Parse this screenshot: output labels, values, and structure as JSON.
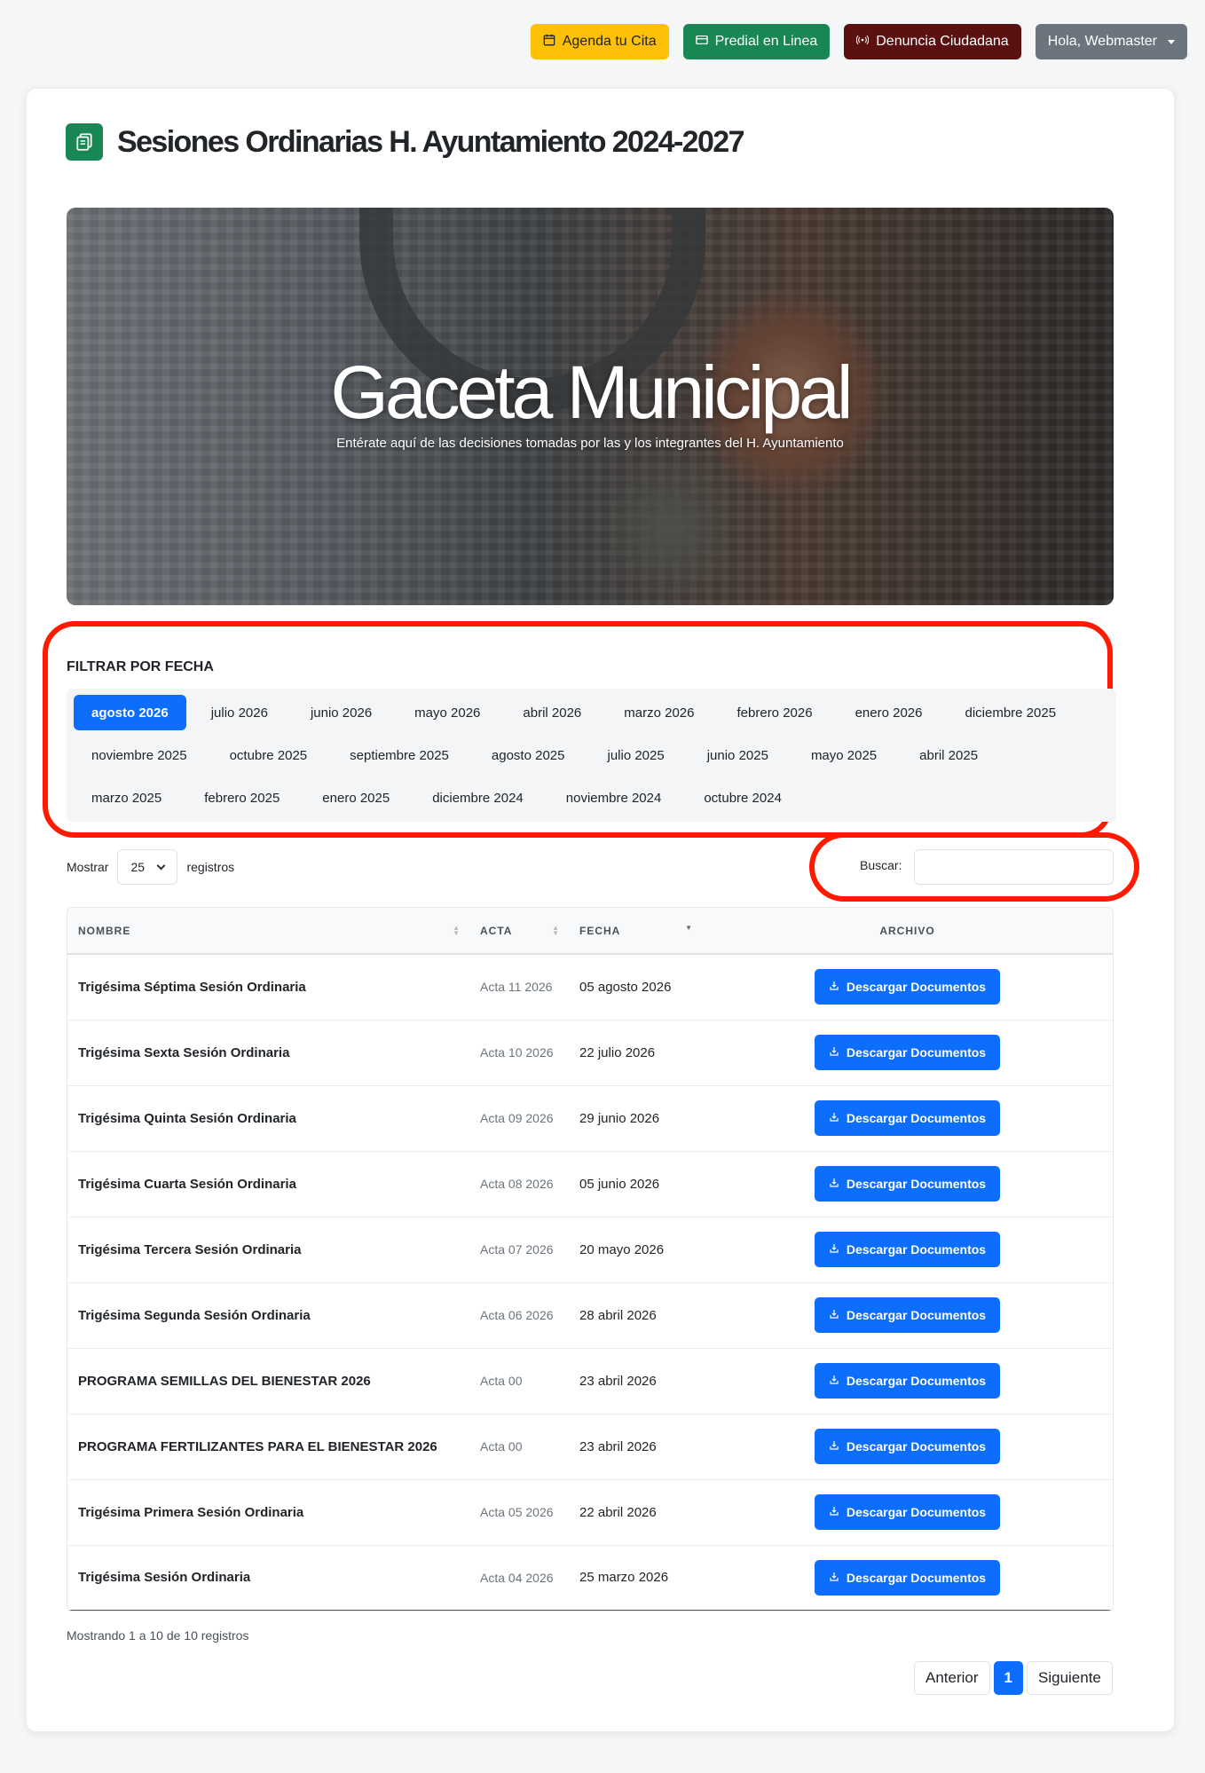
{
  "topbar": {
    "cita": "Agenda tu Cita",
    "predial": "Predial en Linea",
    "denuncia": "Denuncia Ciudadana",
    "user": "Hola, Webmaster"
  },
  "page_title": "Sesiones Ordinarias H. Ayuntamiento 2024-2027",
  "hero": {
    "title": "Gaceta Municipal",
    "subtitle": "Entérate aquí de las decisiones tomadas por las y los integrantes del H. Ayuntamiento"
  },
  "filter": {
    "label": "FILTRAR POR FECHA",
    "months": [
      "agosto 2026",
      "julio 2026",
      "junio 2026",
      "mayo 2026",
      "abril 2026",
      "marzo 2026",
      "febrero 2026",
      "enero 2026",
      "diciembre 2025",
      "noviembre 2025",
      "octubre 2025",
      "septiembre 2025",
      "agosto 2025",
      "julio 2025",
      "junio 2025",
      "mayo 2025",
      "abril 2025",
      "marzo 2025",
      "febrero 2025",
      "enero 2025",
      "diciembre 2024",
      "noviembre 2024",
      "octubre 2024"
    ],
    "active": "agosto 2026"
  },
  "controls": {
    "show_label": "Mostrar",
    "page_size": "25",
    "records_label": "registros",
    "search_label": "Buscar:",
    "search_value": ""
  },
  "table": {
    "headers": [
      "NOMBRE",
      "ACTA",
      "FECHA",
      "ARCHIVO"
    ],
    "button_label": "Descargar Documentos",
    "rows": [
      {
        "nombre": "Trigésima Séptima Sesión Ordinaria",
        "acta": "Acta 11 2026",
        "fecha": "05 agosto 2026"
      },
      {
        "nombre": "Trigésima Sexta Sesión Ordinaria",
        "acta": "Acta 10 2026",
        "fecha": "22 julio 2026"
      },
      {
        "nombre": "Trigésima Quinta Sesión Ordinaria",
        "acta": "Acta 09 2026",
        "fecha": "29 junio 2026"
      },
      {
        "nombre": "Trigésima Cuarta Sesión Ordinaria",
        "acta": "Acta 08 2026",
        "fecha": "05 junio 2026"
      },
      {
        "nombre": "Trigésima Tercera Sesión Ordinaria",
        "acta": "Acta 07 2026",
        "fecha": "20 mayo 2026"
      },
      {
        "nombre": "Trigésima Segunda Sesión Ordinaria",
        "acta": "Acta 06 2026",
        "fecha": "28 abril 2026"
      },
      {
        "nombre": "PROGRAMA SEMILLAS DEL BIENESTAR 2026",
        "acta": "Acta 00",
        "fecha": "23 abril 2026"
      },
      {
        "nombre": "PROGRAMA FERTILIZANTES PARA EL BIENESTAR 2026",
        "acta": "Acta 00",
        "fecha": "23 abril 2026"
      },
      {
        "nombre": "Trigésima Primera Sesión Ordinaria",
        "acta": "Acta 05 2026",
        "fecha": "22 abril 2026"
      },
      {
        "nombre": "Trigésima Sesión Ordinaria",
        "acta": "Acta 04 2026",
        "fecha": "25 marzo 2026"
      }
    ]
  },
  "footer": {
    "info": "Mostrando 1 a 10 de 10 registros",
    "prev": "Anterior",
    "page": "1",
    "next": "Siguiente"
  }
}
